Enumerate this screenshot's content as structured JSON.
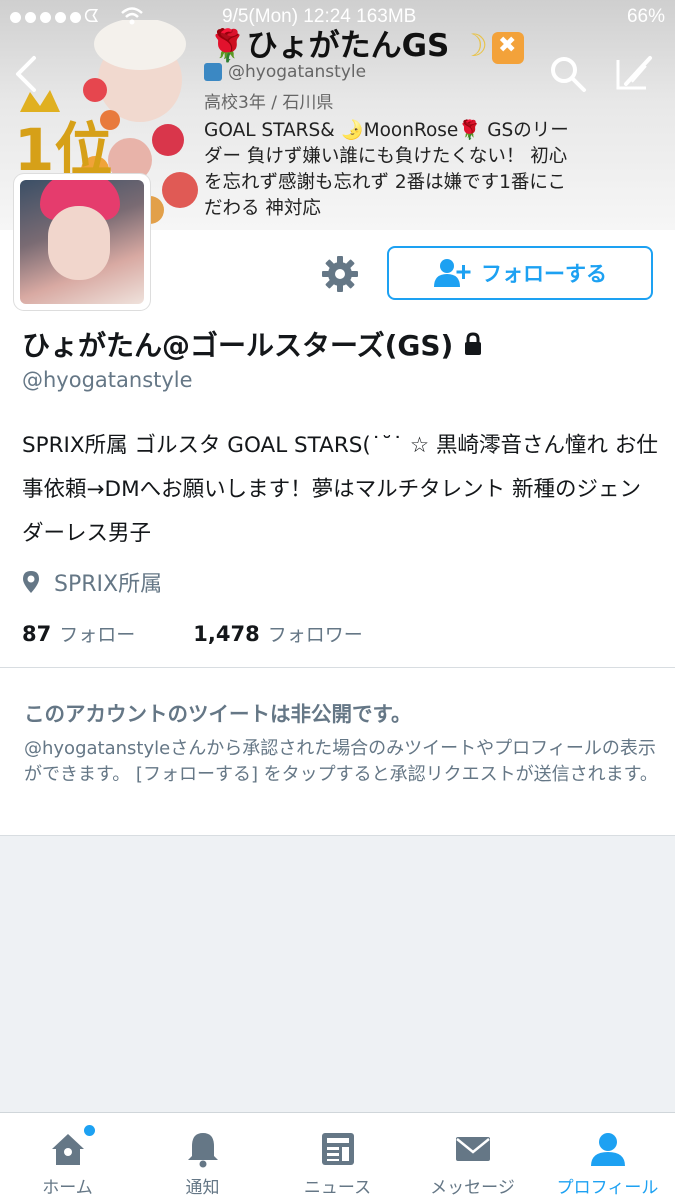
{
  "status_bar": {
    "time": "9/5(Mon) 12:24 163MB",
    "battery": "66%"
  },
  "header": {
    "banner_title": "ひょがたんGS",
    "banner_handle": "@hyogatanstyle",
    "banner_school": "高校3年 / 石川県",
    "banner_text": "GOAL STARS& 🌛MoonRose🌹 GSのリーダー 負けず嫌い誰にも負けたくない！ 初心を忘れず感謝も忘れず 2番は嫌です1番にこだわる 神対応",
    "rank_label": "1位"
  },
  "actions": {
    "follow_label": "フォローする"
  },
  "profile": {
    "name": "ひょがたん@ゴールスターズ(GS)",
    "handle": "@hyogatanstyle",
    "bio": "SPRIX所属 ゴルスタ GOAL STARS(˙˘˙ ☆ 黒崎澪音さん憧れ お仕事依頼→DMへお願いします！夢はマルチタレント 新種のジェンダーレス男子",
    "location": "SPRIX所属",
    "following_count": "87",
    "following_label": "フォロー",
    "followers_count": "1,478",
    "followers_label": "フォロワー"
  },
  "private_notice": {
    "title": "このアカウントのツイートは非公開です。",
    "text": "@hyogatanstyleさんから承認された場合のみツイートやプロフィールの表示ができます。 [フォローする] をタップすると承認リクエストが送信されます。"
  },
  "tabbar": {
    "tabs": [
      {
        "label": "ホーム",
        "icon": "home-icon"
      },
      {
        "label": "通知",
        "icon": "bell-icon"
      },
      {
        "label": "ニュース",
        "icon": "news-icon"
      },
      {
        "label": "メッセージ",
        "icon": "envelope-icon"
      },
      {
        "label": "プロフィール",
        "icon": "person-icon"
      }
    ],
    "active_index": 4
  },
  "colors": {
    "accent": "#1da1f2",
    "muted": "#657786",
    "text": "#14171a"
  }
}
